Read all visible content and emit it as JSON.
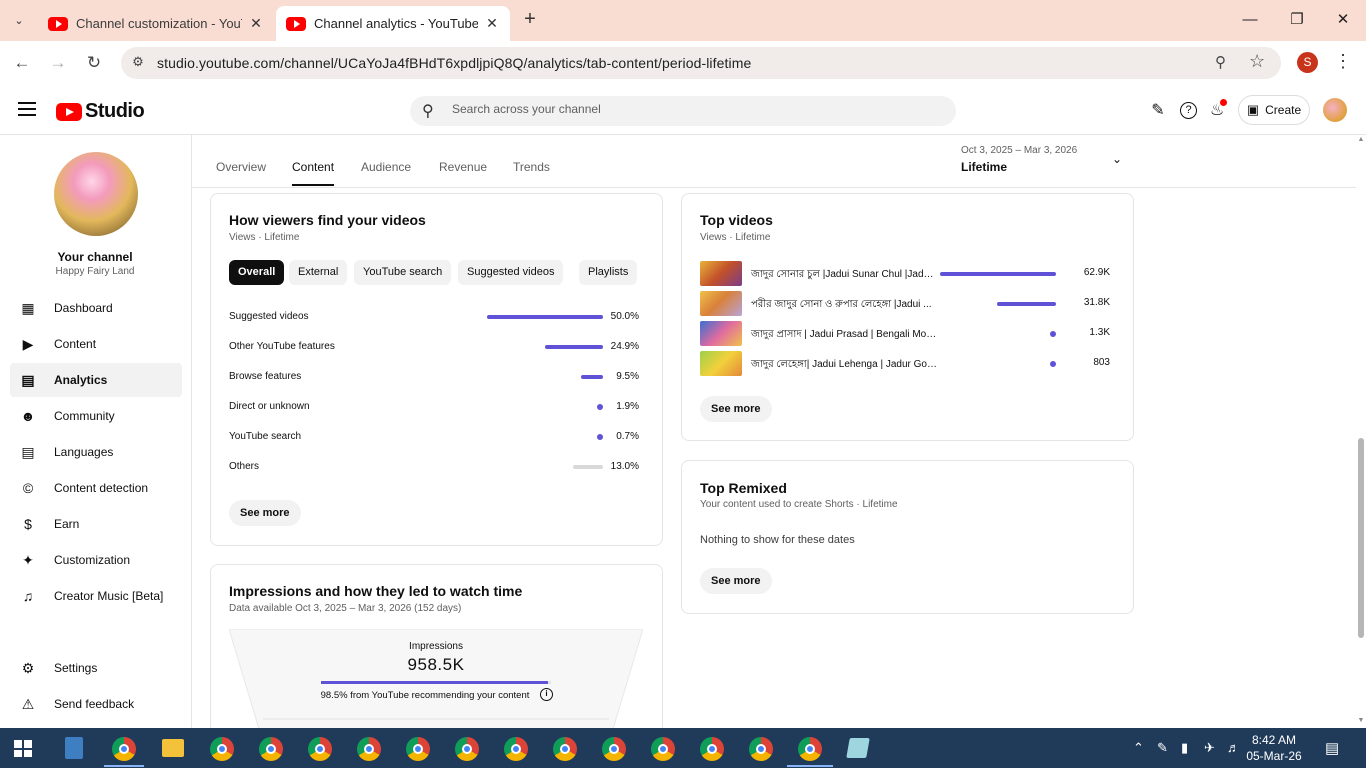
{
  "browser": {
    "tabs": [
      {
        "title": "Channel customization - YouTube Studio",
        "active": false
      },
      {
        "title": "Channel analytics - YouTube Studio",
        "active": true
      }
    ],
    "url": "studio.youtube.com/channel/UCaYoJa4fBHdT6xpdljpiQ8Q/analytics/tab-content/period-lifetime",
    "profile_initial": "S"
  },
  "header": {
    "logo_text": "Studio",
    "search_placeholder": "Search across your channel",
    "create_label": "Create"
  },
  "sidebar": {
    "channel_title": "Your channel",
    "channel_name": "Happy Fairy Land",
    "items": [
      {
        "label": "Dashboard",
        "icon": "dashboard-icon"
      },
      {
        "label": "Content",
        "icon": "content-icon"
      },
      {
        "label": "Analytics",
        "icon": "analytics-icon",
        "active": true
      },
      {
        "label": "Community",
        "icon": "community-icon"
      },
      {
        "label": "Languages",
        "icon": "languages-icon"
      },
      {
        "label": "Content detection",
        "icon": "copyright-icon"
      },
      {
        "label": "Earn",
        "icon": "earn-icon"
      },
      {
        "label": "Customization",
        "icon": "customization-icon"
      },
      {
        "label": "Creator Music [Beta]",
        "icon": "music-icon"
      }
    ],
    "bottom_items": [
      {
        "label": "Settings",
        "icon": "settings-icon"
      },
      {
        "label": "Send feedback",
        "icon": "feedback-icon"
      }
    ]
  },
  "analytics": {
    "tabs": [
      "Overview",
      "Content",
      "Audience",
      "Revenue",
      "Trends"
    ],
    "active_tab": "Content",
    "date_range": "Oct 3, 2025 – Mar 3, 2026",
    "period": "Lifetime"
  },
  "how_viewers_find": {
    "title": "How viewers find your videos",
    "subtitle": "Views · Lifetime",
    "chips": [
      "Overall",
      "External",
      "YouTube search",
      "Suggested videos",
      "Playlists"
    ],
    "active_chip": "Overall",
    "rows": [
      {
        "label": "Suggested videos",
        "percent": "50.0%",
        "value": 50.0,
        "grey": false
      },
      {
        "label": "Other YouTube features",
        "percent": "24.9%",
        "value": 24.9,
        "grey": false
      },
      {
        "label": "Browse features",
        "percent": "9.5%",
        "value": 9.5,
        "grey": false
      },
      {
        "label": "Direct or unknown",
        "percent": "1.9%",
        "value": 1.9,
        "grey": false
      },
      {
        "label": "YouTube search",
        "percent": "0.7%",
        "value": 0.7,
        "grey": false
      },
      {
        "label": "Others",
        "percent": "13.0%",
        "value": 13.0,
        "grey": true
      }
    ],
    "see_more": "See more"
  },
  "top_videos": {
    "title": "Top videos",
    "subtitle": "Views · Lifetime",
    "videos": [
      {
        "title": "জাদুর সোনার চুল |Jadui Sunar Chul |Jadu...",
        "views": "62.9K",
        "value": 62900
      },
      {
        "title": "পরীর জাদুর সোনা ও রুপার লেহেঙ্গা |Jadui ...",
        "views": "31.8K",
        "value": 31800
      },
      {
        "title": "জাদুর প্রাসাদ | Jadui Prasad | Bengali Mor...",
        "views": "1.3K",
        "value": 1300
      },
      {
        "title": "জাদুর লেহেঙ্গা| Jadui Lehenga | Jadur Gol...",
        "views": "803",
        "value": 803
      }
    ],
    "see_more": "See more"
  },
  "top_remixed": {
    "title": "Top Remixed",
    "subtitle": "Your content used to create Shorts · Lifetime",
    "empty_text": "Nothing to show for these dates",
    "see_more": "See more"
  },
  "impressions": {
    "title": "Impressions and how they led to watch time",
    "subtitle": "Data available Oct 3, 2025 – Mar 3, 2026 (152 days)",
    "label": "Impressions",
    "value": "958.5K",
    "recommend_percent": 98.5,
    "note": "98.5% from YouTube recommending your content"
  },
  "taskbar": {
    "time": "8:42 AM",
    "date": "05-Mar-26"
  },
  "colors": {
    "accent": "#5f52d6",
    "youtube_red": "#ff0000",
    "tabstrip": "#f9dcd2",
    "taskbar": "#203b5a"
  }
}
